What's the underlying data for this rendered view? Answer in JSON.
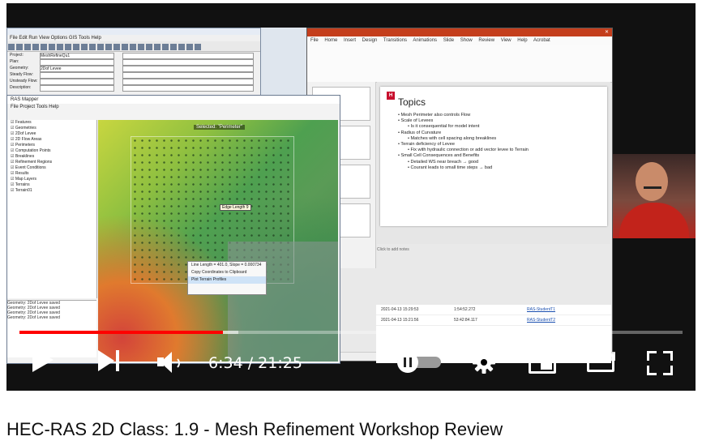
{
  "player": {
    "time_current": "6:34",
    "time_total": "21:25",
    "time_display": "6:34 / 21:25",
    "progress_fraction": 0.307,
    "buffered_fraction": 0.33,
    "autoplay_on": true,
    "accent_color": "#ff0000"
  },
  "video_title": "HEC-RAS 2D Class: 1.9 - Mesh Refinement Workshop Review",
  "screen": {
    "ras_main": {
      "menu": "File  Edit  Run  View  Options  GIS Tools  Help",
      "rows": [
        {
          "label": "Project:",
          "value": "MeshRefineQu1"
        },
        {
          "label": "Plan:",
          "value": ""
        },
        {
          "label": "Geometry:",
          "value": "2Dof Levee"
        },
        {
          "label": "Steady Flow:",
          "value": ""
        },
        {
          "label": "Unsteady Flow:",
          "value": ""
        },
        {
          "label": "Description:",
          "value": ""
        }
      ]
    },
    "mapper": {
      "title": "RAS Mapper",
      "menu": "File  Project  Tools  Help",
      "layers": [
        "Features",
        "Geometries",
        "2Dof Levee",
        "2D Flow Areas",
        "Perimeters",
        "Computation Points",
        "Breaklines",
        "Refinement Regions",
        "Event Conditions",
        "Results",
        "Map Layers",
        "Terrains",
        "Terrain01"
      ],
      "selected_label": "Selected: \"Perimeter\"",
      "tooltip": "Edge Length 9",
      "context_menu": [
        "Line Length = 401.0, Slope = 0.000734",
        "Copy Coordinates to Clipboard",
        "Plot Terrain Profiles"
      ],
      "messages": [
        "Geometry: 2Dof Levee saved",
        "Geometry: 2Dof Levee saved",
        "Geometry: 2Dof Levee saved",
        "Geometry: 2Dof Levee saved"
      ]
    },
    "powerpoint": {
      "tabs": "File  Home  Insert  Design  Transitions  Animations  Slide Show  Review  View  Help  Acrobat",
      "slide_title": "Topics",
      "bullets": [
        {
          "text": "• Mesh Perimeter also controls Flow",
          "level": 1
        },
        {
          "text": "• Scale of Levees",
          "level": 1
        },
        {
          "text": "• Is it consequential for model intent",
          "level": 2
        },
        {
          "text": "• Radius of Curvature",
          "level": 1
        },
        {
          "text": "• Matches with cell spacing along breaklines",
          "level": 2
        },
        {
          "text": "• Terrain deficiency of Levee",
          "level": 1
        },
        {
          "text": "• Fix with hydraulic connection or add vector levee to Terrain",
          "level": 2
        },
        {
          "text": "• Small Cell Consequences and Benefits",
          "level": 1
        },
        {
          "text": "• Detailed WS near breach → good",
          "level": 2
        },
        {
          "text": "• Courant leads to small time steps → bad",
          "level": 2
        }
      ],
      "notes_placeholder": "Click to add notes"
    },
    "table": [
      {
        "date": "2021-04-13 15:29:53",
        "time": "1:54:52.272",
        "link": "RAS-StudentT1"
      },
      {
        "date": "2021-04-13 15:21:56",
        "time": "53:42:84.117",
        "link": "RAS-StudentT2"
      }
    ]
  }
}
